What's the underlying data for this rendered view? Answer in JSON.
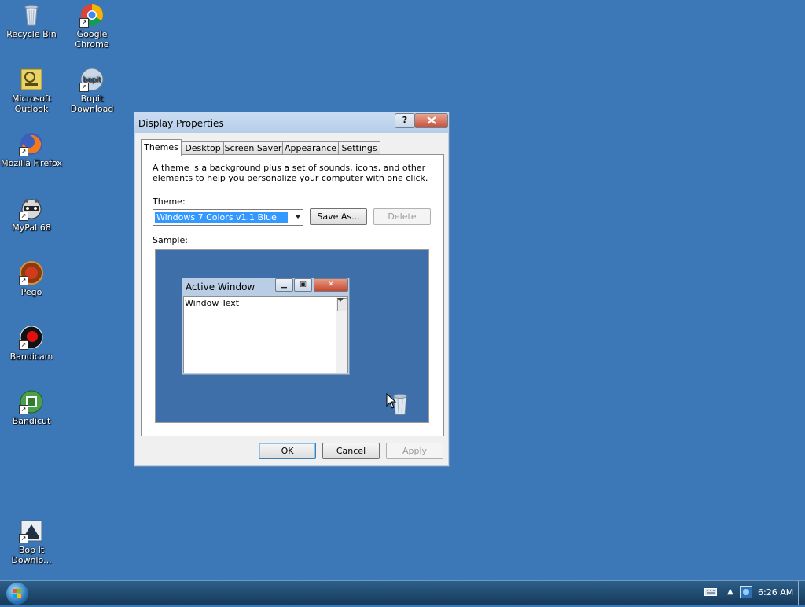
{
  "desktop": {
    "icons": [
      {
        "label": "Recycle Bin",
        "icon": "recycle-bin-icon"
      },
      {
        "label": "Google Chrome",
        "icon": "chrome-icon"
      },
      {
        "label": "Microsoft Outlook",
        "icon": "outlook-icon"
      },
      {
        "label": "Bopit Download",
        "icon": "bopit-icon"
      },
      {
        "label": "Mozilla Firefox",
        "icon": "firefox-icon"
      },
      {
        "label": "MyPal 68",
        "icon": "mypal-icon"
      },
      {
        "label": "Pego",
        "icon": "pego-icon"
      },
      {
        "label": "Bandicam",
        "icon": "bandicam-icon"
      },
      {
        "label": "Bandicut",
        "icon": "bandicut-icon"
      },
      {
        "label": "Bop It Downlo...",
        "icon": "bopit-download-icon"
      }
    ]
  },
  "dialog": {
    "title": "Display Properties",
    "help_label": "?",
    "tabs": [
      {
        "label": "Themes"
      },
      {
        "label": "Desktop"
      },
      {
        "label": "Screen Saver"
      },
      {
        "label": "Appearance"
      },
      {
        "label": "Settings"
      }
    ],
    "description": "A theme is a background plus a set of sounds, icons, and other elements to help you personalize your computer with one click.",
    "theme_label": "Theme:",
    "theme_value": "Windows 7 Colors v1.1 Blue",
    "save_as_label": "Save As...",
    "delete_label": "Delete",
    "sample_label": "Sample:",
    "sample": {
      "window_title": "Active Window",
      "window_text": "Window Text"
    },
    "ok_label": "OK",
    "cancel_label": "Cancel",
    "apply_label": "Apply"
  },
  "taskbar": {
    "clock": "6:26 AM"
  },
  "colors": {
    "desktop": "#3c78b8",
    "selection": "#3399ff"
  }
}
